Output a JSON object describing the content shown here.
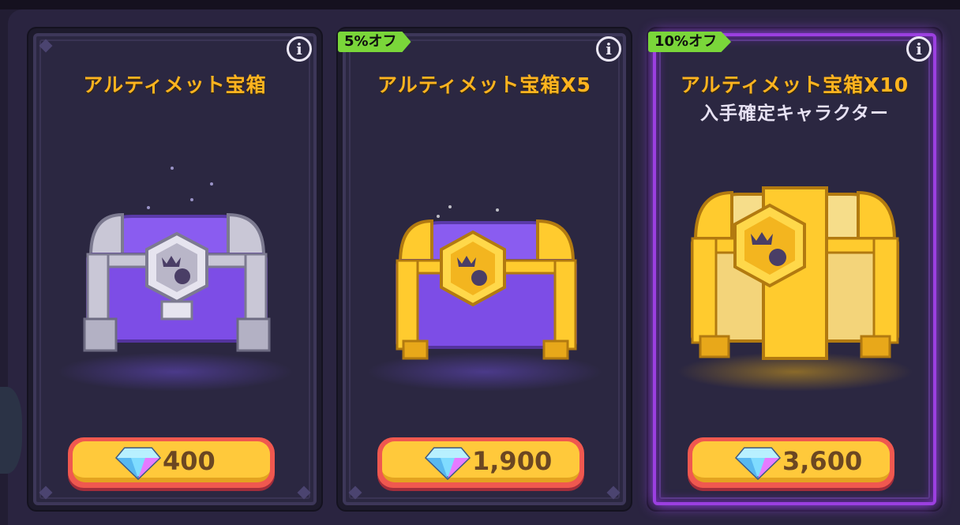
{
  "cards": [
    {
      "title": "アルティメット宝箱",
      "subtitle": "",
      "discount": "",
      "price": "400",
      "chest": "purple-silver-chest"
    },
    {
      "title": "アルティメット宝箱X5",
      "subtitle": "",
      "discount": "5%オフ",
      "price": "1,900",
      "chest": "purple-gold-chest"
    },
    {
      "title": "アルティメット宝箱X10",
      "subtitle": "入手確定キャラクター",
      "discount": "10%オフ",
      "price": "3,600",
      "chest": "gold-chest"
    }
  ],
  "info_label": "i",
  "colors": {
    "title": "#ffb41f",
    "discount": "#7ad63a",
    "price_button": "#ffc93b",
    "special_glow": "#a84dff"
  }
}
